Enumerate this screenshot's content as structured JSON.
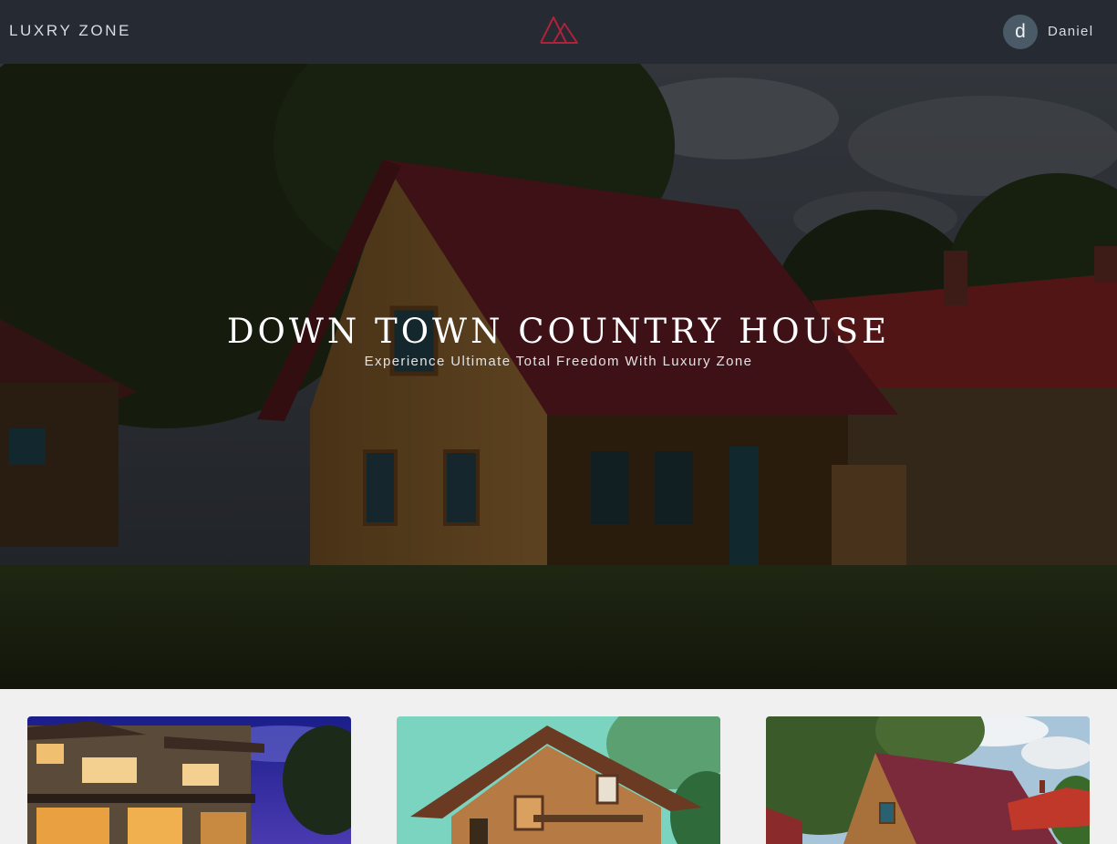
{
  "header": {
    "brand": "LUXRY ZONE",
    "logo_icon": "mountain-logo-icon",
    "user": {
      "initial": "d",
      "name": "Daniel"
    }
  },
  "hero": {
    "title": "DOWN TOWN COUNTRY HOUSE",
    "subtitle": "Experience Ultimate Total Freedom With Luxury Zone"
  },
  "cards": [
    {
      "image": "modern-house-night-photo"
    },
    {
      "image": "wooden-stilt-house-photo"
    },
    {
      "image": "wooden-cottage-photo"
    }
  ],
  "colors": {
    "header_bg": "#262a33",
    "accent": "#b0213a",
    "avatar_bg": "#4a5a66",
    "page_bg": "#f0f0f0"
  }
}
